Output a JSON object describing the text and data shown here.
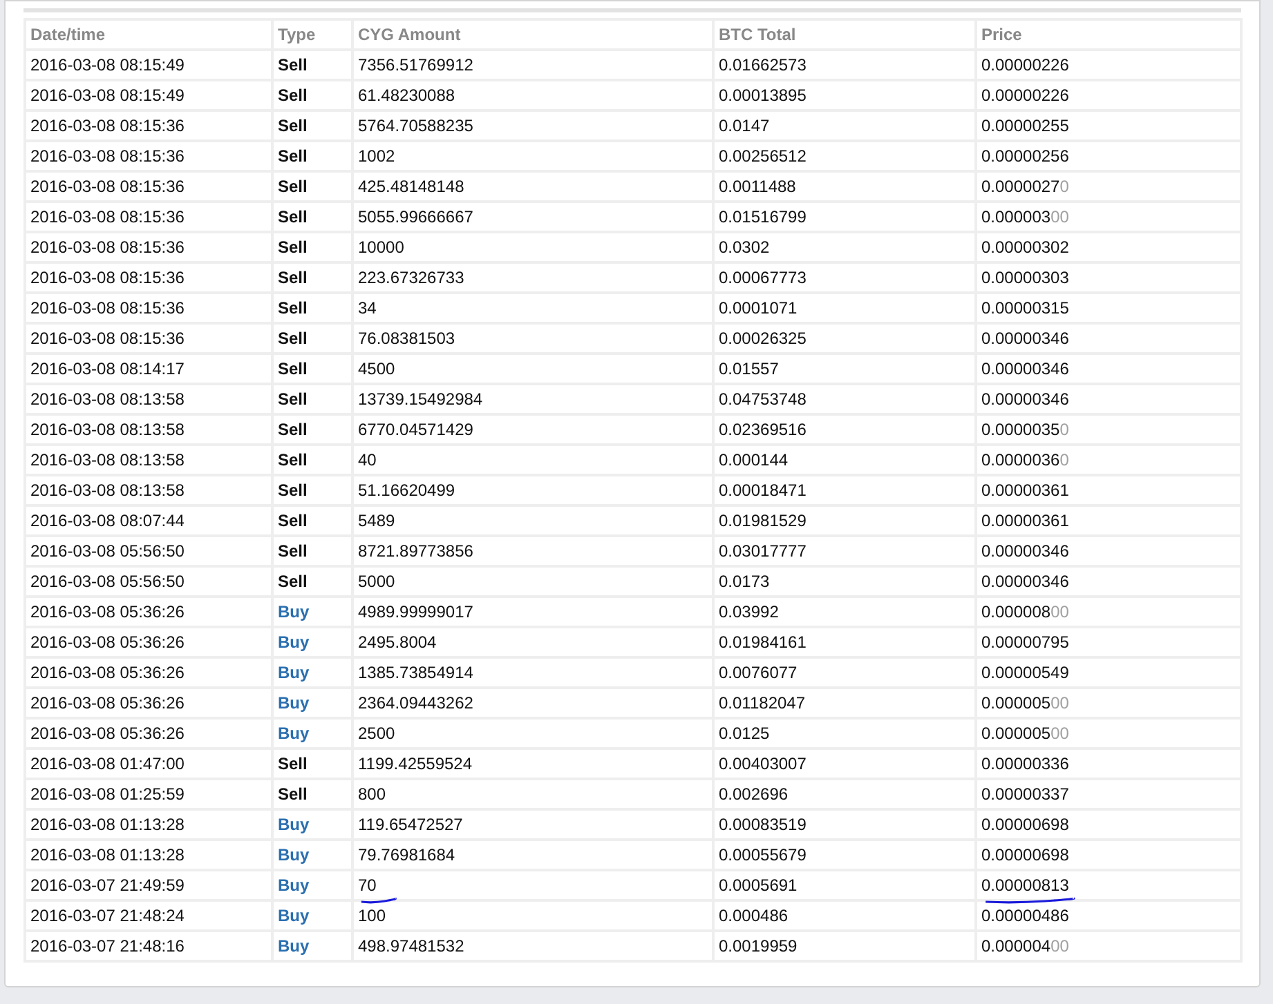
{
  "table": {
    "columns": [
      "Date/time",
      "Type",
      "CYG Amount",
      "BTC Total",
      "Price"
    ],
    "rows": [
      {
        "datetime": "2016-03-08 08:15:49",
        "type": "Sell",
        "amount": "7356.51769912",
        "total": "0.01662573",
        "price": "0.00000226"
      },
      {
        "datetime": "2016-03-08 08:15:49",
        "type": "Sell",
        "amount": "61.48230088",
        "total": "0.00013895",
        "price": "0.00000226"
      },
      {
        "datetime": "2016-03-08 08:15:36",
        "type": "Sell",
        "amount": "5764.70588235",
        "total": "0.0147",
        "price": "0.00000255"
      },
      {
        "datetime": "2016-03-08 08:15:36",
        "type": "Sell",
        "amount": "1002",
        "total": "0.00256512",
        "price": "0.00000256"
      },
      {
        "datetime": "2016-03-08 08:15:36",
        "type": "Sell",
        "amount": "425.48148148",
        "total": "0.0011488",
        "price": "0.0000027",
        "price_tail": "0"
      },
      {
        "datetime": "2016-03-08 08:15:36",
        "type": "Sell",
        "amount": "5055.99666667",
        "total": "0.01516799",
        "price": "0.000003",
        "price_tail": "00"
      },
      {
        "datetime": "2016-03-08 08:15:36",
        "type": "Sell",
        "amount": "10000",
        "total": "0.0302",
        "price": "0.00000302"
      },
      {
        "datetime": "2016-03-08 08:15:36",
        "type": "Sell",
        "amount": "223.67326733",
        "total": "0.00067773",
        "price": "0.00000303"
      },
      {
        "datetime": "2016-03-08 08:15:36",
        "type": "Sell",
        "amount": "34",
        "total": "0.0001071",
        "price": "0.00000315"
      },
      {
        "datetime": "2016-03-08 08:15:36",
        "type": "Sell",
        "amount": "76.08381503",
        "total": "0.00026325",
        "price": "0.00000346"
      },
      {
        "datetime": "2016-03-08 08:14:17",
        "type": "Sell",
        "amount": "4500",
        "total": "0.01557",
        "price": "0.00000346"
      },
      {
        "datetime": "2016-03-08 08:13:58",
        "type": "Sell",
        "amount": "13739.15492984",
        "total": "0.04753748",
        "price": "0.00000346"
      },
      {
        "datetime": "2016-03-08 08:13:58",
        "type": "Sell",
        "amount": "6770.04571429",
        "total": "0.02369516",
        "price": "0.0000035",
        "price_tail": "0"
      },
      {
        "datetime": "2016-03-08 08:13:58",
        "type": "Sell",
        "amount": "40",
        "total": "0.000144",
        "price": "0.0000036",
        "price_tail": "0"
      },
      {
        "datetime": "2016-03-08 08:13:58",
        "type": "Sell",
        "amount": "51.16620499",
        "total": "0.00018471",
        "price": "0.00000361"
      },
      {
        "datetime": "2016-03-08 08:07:44",
        "type": "Sell",
        "amount": "5489",
        "total": "0.01981529",
        "price": "0.00000361"
      },
      {
        "datetime": "2016-03-08 05:56:50",
        "type": "Sell",
        "amount": "8721.89773856",
        "total": "0.03017777",
        "price": "0.00000346"
      },
      {
        "datetime": "2016-03-08 05:56:50",
        "type": "Sell",
        "amount": "5000",
        "total": "0.0173",
        "price": "0.00000346"
      },
      {
        "datetime": "2016-03-08 05:36:26",
        "type": "Buy",
        "amount": "4989.99999017",
        "total": "0.03992",
        "price": "0.000008",
        "price_tail": "00"
      },
      {
        "datetime": "2016-03-08 05:36:26",
        "type": "Buy",
        "amount": "2495.8004",
        "total": "0.01984161",
        "price": "0.00000795"
      },
      {
        "datetime": "2016-03-08 05:36:26",
        "type": "Buy",
        "amount": "1385.73854914",
        "total": "0.0076077",
        "price": "0.00000549"
      },
      {
        "datetime": "2016-03-08 05:36:26",
        "type": "Buy",
        "amount": "2364.09443262",
        "total": "0.01182047",
        "price": "0.000005",
        "price_tail": "00"
      },
      {
        "datetime": "2016-03-08 05:36:26",
        "type": "Buy",
        "amount": "2500",
        "total": "0.0125",
        "price": "0.000005",
        "price_tail": "00"
      },
      {
        "datetime": "2016-03-08 01:47:00",
        "type": "Sell",
        "amount": "1199.42559524",
        "total": "0.00403007",
        "price": "0.00000336"
      },
      {
        "datetime": "2016-03-08 01:25:59",
        "type": "Sell",
        "amount": "800",
        "total": "0.002696",
        "price": "0.00000337"
      },
      {
        "datetime": "2016-03-08 01:13:28",
        "type": "Buy",
        "amount": "119.65472527",
        "total": "0.00083519",
        "price": "0.00000698"
      },
      {
        "datetime": "2016-03-08 01:13:28",
        "type": "Buy",
        "amount": "79.76981684",
        "total": "0.00055679",
        "price": "0.00000698"
      },
      {
        "datetime": "2016-03-07 21:49:59",
        "type": "Buy",
        "amount": "70",
        "total": "0.0005691",
        "price": "0.00000813",
        "amount_underlined": true,
        "price_underlined": true
      },
      {
        "datetime": "2016-03-07 21:48:24",
        "type": "Buy",
        "amount": "100",
        "total": "0.000486",
        "price": "0.00000486"
      },
      {
        "datetime": "2016-03-07 21:48:16",
        "type": "Buy",
        "amount": "498.97481532",
        "total": "0.0019959",
        "price": "0.000004",
        "price_tail": "00"
      }
    ]
  }
}
